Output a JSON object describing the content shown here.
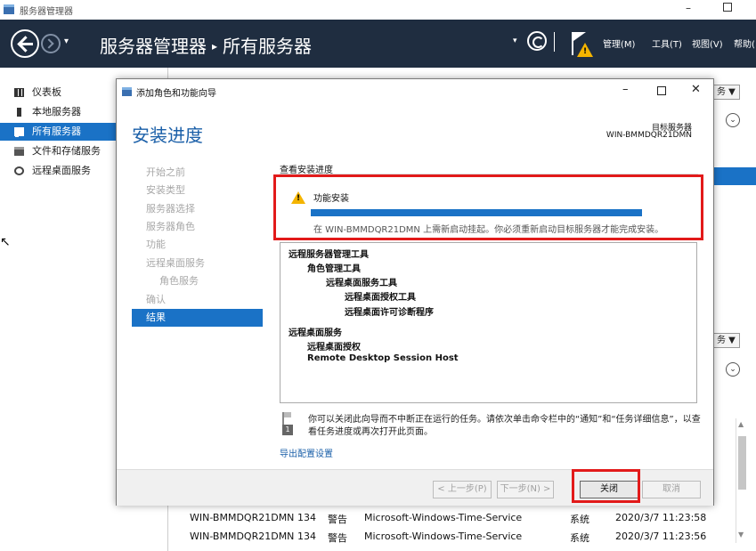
{
  "window": {
    "title": "服务器管理器",
    "minimize": "–"
  },
  "header": {
    "dropdown_arrow": "▾",
    "breadcrumb_root": "服务器管理器",
    "breadcrumb_separator": "▸",
    "breadcrumb_current": "所有服务器",
    "refresh_dropdown": "▾",
    "menus": [
      "管理(M)",
      "工具(T)",
      "视图(V)",
      "帮助("
    ]
  },
  "sidebar": {
    "items": [
      {
        "label": "仪表板",
        "icon": "dashboard-icon"
      },
      {
        "label": "本地服务器",
        "icon": "local-server-icon"
      },
      {
        "label": "所有服务器",
        "icon": "all-servers-icon",
        "active": true
      },
      {
        "label": "文件和存储服务",
        "icon": "file-storage-icon"
      },
      {
        "label": "远程桌面服务",
        "icon": "remote-desktop-icon"
      }
    ]
  },
  "background": {
    "tasks_label_1": "务 ▼",
    "tasks_label_2": "务 ▼",
    "events": [
      {
        "server": "WIN-BMMDQR21DMN",
        "id": "134",
        "level": "警告",
        "source": "Microsoft-Windows-Time-Service",
        "log": "系统",
        "datetime": "2020/3/7 11:23:58"
      },
      {
        "server": "WIN-BMMDQR21DMN",
        "id": "134",
        "level": "警告",
        "source": "Microsoft-Windows-Time-Service",
        "log": "系统",
        "datetime": "2020/3/7 11:23:56"
      }
    ]
  },
  "dialog": {
    "title": "添加角色和功能向导",
    "controls": {
      "minimize": "–",
      "close": "✕"
    },
    "heading": "安装进度",
    "destination_label": "目标服务器",
    "destination_server": "WIN-BMMDQR21DMN",
    "steps": [
      {
        "label": "开始之前",
        "sub": false
      },
      {
        "label": "安装类型",
        "sub": false
      },
      {
        "label": "服务器选择",
        "sub": false
      },
      {
        "label": "服务器角色",
        "sub": false
      },
      {
        "label": "功能",
        "sub": false
      },
      {
        "label": "远程桌面服务",
        "sub": false
      },
      {
        "label": "角色服务",
        "sub": true
      },
      {
        "label": "确认",
        "sub": false
      },
      {
        "label": "结果",
        "sub": false,
        "active": true
      }
    ],
    "section_title": "查看安装进度",
    "status": {
      "label": "功能安装",
      "progress": 1.0,
      "message": "在 WIN-BMMDQR21DMN 上需新启动挂起。你必须重新启动目标服务器才能完成安装。"
    },
    "results": [
      {
        "text": "远程服务器管理工具",
        "level": 0
      },
      {
        "text": "角色管理工具",
        "level": 1
      },
      {
        "text": "远程桌面服务工具",
        "level": 2
      },
      {
        "text": "远程桌面授权工具",
        "level": 3
      },
      {
        "text": "远程桌面许可诊断程序",
        "level": 3
      },
      {
        "text": "远程桌面服务",
        "level": 0,
        "gap": true
      },
      {
        "text": "远程桌面授权",
        "level": 1
      },
      {
        "text": "Remote Desktop Session Host",
        "level": 1
      }
    ],
    "note_badge": "1",
    "note": "你可以关闭此向导而不中断正在运行的任务。请依次单击命令栏中的“通知”和“任务详细信息”，以查看任务进度或再次打开此页面。",
    "export_link": "导出配置设置",
    "buttons": {
      "previous": "< 上一步(P)",
      "next": "下一步(N) >",
      "close": "关闭",
      "cancel": "取消"
    }
  },
  "colors": {
    "accent": "#1a72c6",
    "header_bg": "#1f2d40",
    "highlight_red": "#e21a1a",
    "warning": "#f4b400"
  }
}
